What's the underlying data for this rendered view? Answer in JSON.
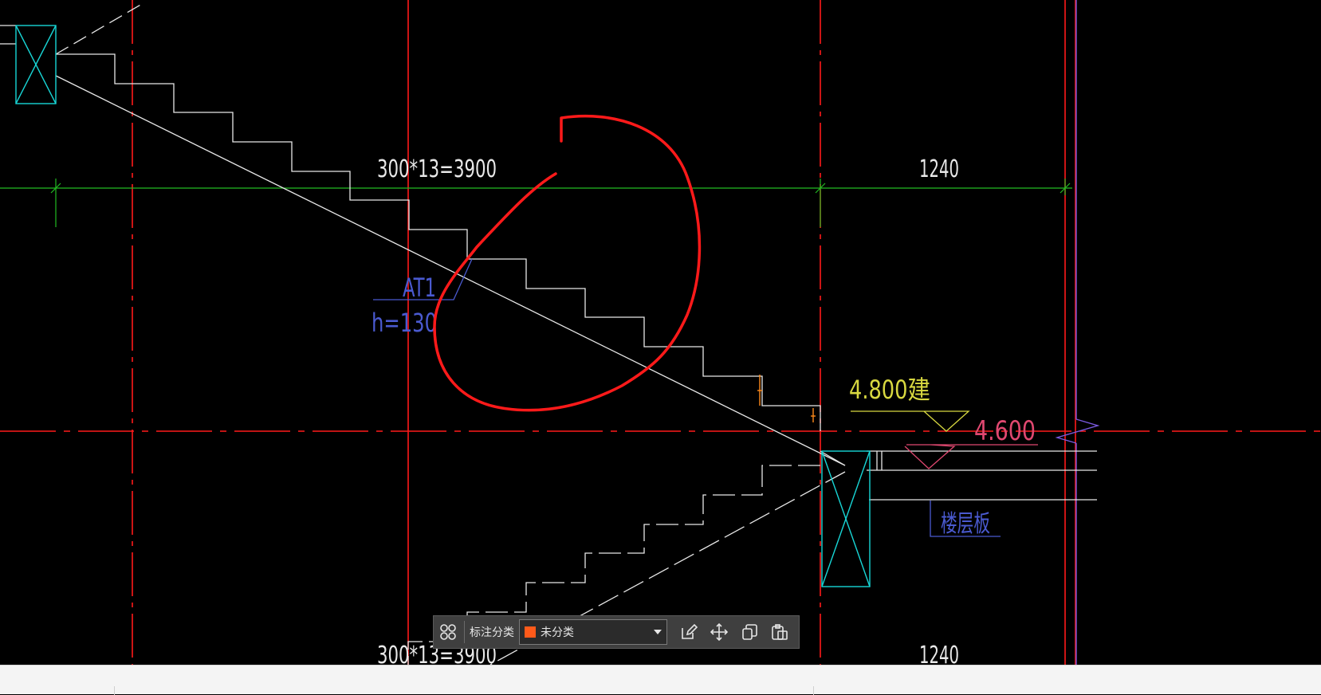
{
  "drawing": {
    "dim_run_top": "300*13=3900",
    "dim_landing_top": "1240",
    "dim_run_bottom": "300*13=3900",
    "dim_landing_bottom": "1240",
    "stair_tag": "AT1",
    "stair_thickness": "h=130",
    "elev_arch": "4.800建",
    "elev_struct": "4.600",
    "floor_slab_label": "楼层板"
  },
  "toolbar": {
    "category_label": "标注分类",
    "category_value": "未分类",
    "swatch_color": "#ff5a1a",
    "icons": [
      "grid-icon",
      "edit-icon",
      "move-icon",
      "copy-icon",
      "paste-icon"
    ]
  },
  "colors": {
    "background": "#000000",
    "axis_red": "#ff1a1a",
    "dimension_green": "#22bb22",
    "column_cyan": "#18d6d6",
    "stair_white": "#e8e8e8",
    "tag_blue": "#4a5ad0",
    "markup_red": "#ff1a1a",
    "elevation_yellow": "#d8d840",
    "elevation_pink": "#e04870",
    "boundary_purple": "#7a5ae0"
  }
}
